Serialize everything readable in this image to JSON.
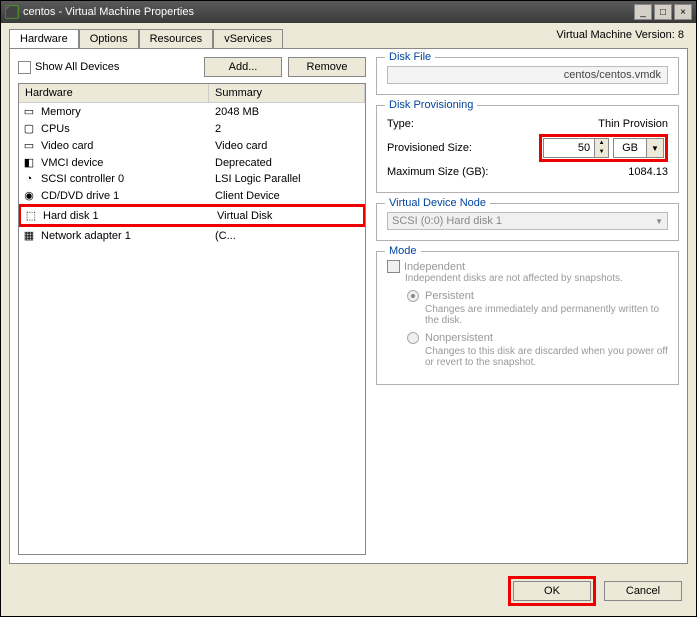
{
  "window": {
    "title": "centos - Virtual Machine Properties"
  },
  "version": "Virtual Machine Version: 8",
  "tabs": [
    "Hardware",
    "Options",
    "Resources",
    "vServices"
  ],
  "toolbar": {
    "show_all": "Show All Devices",
    "add": "Add...",
    "remove": "Remove"
  },
  "hw_head": {
    "col1": "Hardware",
    "col2": "Summary"
  },
  "hw": [
    {
      "icon": "▭",
      "name": "Memory",
      "summary": "2048 MB"
    },
    {
      "icon": "▢",
      "name": "CPUs",
      "summary": "2"
    },
    {
      "icon": "▭",
      "name": "Video card",
      "summary": "Video card"
    },
    {
      "icon": "◧",
      "name": "VMCI device",
      "summary": "Deprecated"
    },
    {
      "icon": "◔",
      "name": "SCSI controller 0",
      "summary": "LSI Logic Parallel"
    },
    {
      "icon": "◉",
      "name": "CD/DVD drive 1",
      "summary": "Client Device"
    },
    {
      "icon": "⬚",
      "name": "Hard disk 1",
      "summary": "Virtual Disk"
    },
    {
      "icon": "▦",
      "name": "Network adapter 1",
      "summary": "(C..."
    }
  ],
  "disk_file": {
    "legend": "Disk File",
    "path": "centos/centos.vmdk"
  },
  "prov": {
    "legend": "Disk Provisioning",
    "type_lbl": "Type:",
    "type_val": "Thin Provision",
    "size_lbl": "Provisioned Size:",
    "size_val": "50",
    "size_unit": "GB",
    "max_lbl": "Maximum Size (GB):",
    "max_val": "1084.13"
  },
  "vdn": {
    "legend": "Virtual Device Node",
    "value": "SCSI (0:0) Hard disk 1"
  },
  "mode": {
    "legend": "Mode",
    "indep": "Independent",
    "indep_desc": "Independent disks are not affected by snapshots.",
    "persist": "Persistent",
    "persist_desc": "Changes are immediately and permanently written to the disk.",
    "nonpersist": "Nonpersistent",
    "nonpersist_desc": "Changes to this disk are discarded when you power off or revert to the snapshot."
  },
  "footer": {
    "ok": "OK",
    "cancel": "Cancel"
  }
}
